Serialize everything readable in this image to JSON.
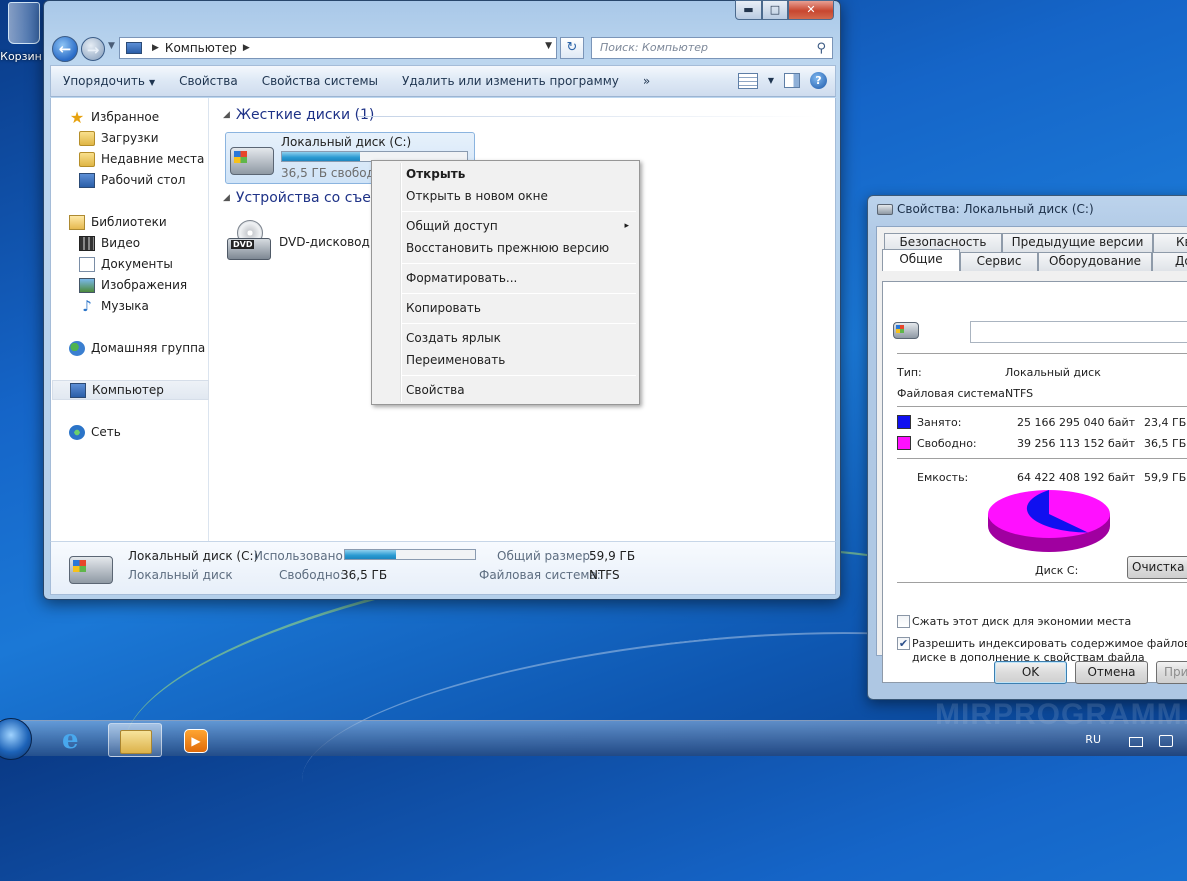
{
  "desktop": {
    "recycle_label": "Корзин",
    "watermark": "MIRPROGRAMM.RU"
  },
  "explorer": {
    "address": {
      "root": "Компьютер",
      "search_placeholder": "Поиск: Компьютер"
    },
    "toolbar": {
      "organize": "Упорядочить",
      "properties": "Свойства",
      "system_properties": "Свойства системы",
      "uninstall": "Удалить или изменить программу",
      "more": "»"
    },
    "nav": {
      "favorites": "Избранное",
      "downloads": "Загрузки",
      "recent": "Недавние места",
      "desktop": "Рабочий стол",
      "libraries": "Библиотеки",
      "video": "Видео",
      "documents": "Документы",
      "images": "Изображения",
      "music": "Музыка",
      "homegroup": "Домашняя группа",
      "computer": "Компьютер",
      "network": "Сеть"
    },
    "groups": {
      "hard_drives": "Жесткие диски (1)",
      "removable": "Устройства со съемными носителями (1)"
    },
    "drive_c": {
      "name": "Локальный диск (C:)",
      "free_text": "36,5 ГБ свободно из 59,9 ГБ",
      "used_fraction": 0.42
    },
    "dvd": {
      "name": "DVD-дисковод (D:)",
      "badge": "DVD"
    },
    "details": {
      "name": "Локальный диск (C:)",
      "type": "Локальный диск",
      "used_label": "Использовано:",
      "free_label": "Свободно:",
      "free_value": "36,5 ГБ",
      "total_label": "Общий размер:",
      "total_value": "59,9 ГБ",
      "fs_label": "Файловая система:",
      "fs_value": "NTFS",
      "used_fraction": 0.39
    }
  },
  "context_menu": {
    "open": "Открыть",
    "open_new_window": "Открыть в новом окне",
    "share": "Общий доступ",
    "share_arrow": "▸",
    "restore": "Восстановить прежнюю версию",
    "format": "Форматировать...",
    "copy": "Копировать",
    "shortcut": "Создать ярлык",
    "rename": "Переименовать",
    "properties": "Свойства"
  },
  "properties": {
    "title": "Свойства: Локальный диск (C:)",
    "tabs_row1": [
      "Безопасность",
      "Предыдущие версии",
      "Квоты"
    ],
    "tabs_row2": [
      "Общие",
      "Сервис",
      "Оборудование",
      "Доступ"
    ],
    "type_label": "Тип:",
    "type_value": "Локальный диск",
    "fs_label": "Файловая система:",
    "fs_value": "NTFS",
    "used_label": "Занято:",
    "used_bytes": "25 166 295 040 байт",
    "used_gb": "23,4 ГБ",
    "free_label": "Свободно:",
    "free_bytes": "39 256 113 152 байт",
    "free_gb": "36,5 ГБ",
    "capacity_label": "Емкость:",
    "capacity_bytes": "64 422 408 192 байт",
    "capacity_gb": "59,9 ГБ",
    "disk_label": "Диск C:",
    "cleanup": "Очистка диска",
    "compress": "Сжать этот диск для экономии места",
    "index_line1": "Разрешить индексировать содержимое файлов на этом",
    "index_line2": "диске в дополнение к свойствам файла",
    "ok": "OK",
    "cancel": "Отмена",
    "apply": "Применить",
    "colors": {
      "used": "#1010f0",
      "free": "#ff10ff"
    },
    "used_fraction": 0.39
  },
  "taskbar": {
    "lang": "RU",
    "ie_glyph": "e",
    "wmp_glyph": "▶"
  }
}
